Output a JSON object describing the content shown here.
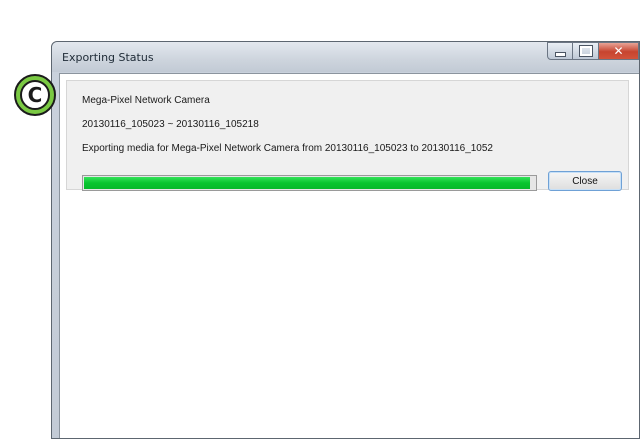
{
  "window": {
    "title": "Exporting Status",
    "caption_buttons": {
      "minimize_icon": "minimize-icon",
      "maximize_icon": "maximize-icon",
      "close_icon": "close-icon",
      "close_glyph": "✕"
    }
  },
  "export": {
    "camera_name": "Mega-Pixel Network Camera",
    "time_range": "20130116_105023 ~ 20130116_105218",
    "status_message": "Exporting media for Mega-Pixel Network Camera from 20130116_105023 to 20130116_1052",
    "progress_fraction": 0.99,
    "progress_color": "#07c52e"
  },
  "buttons": {
    "close_label": "Close"
  },
  "annotation": {
    "marker_letter": "C",
    "marker_color": "#7ac943"
  }
}
